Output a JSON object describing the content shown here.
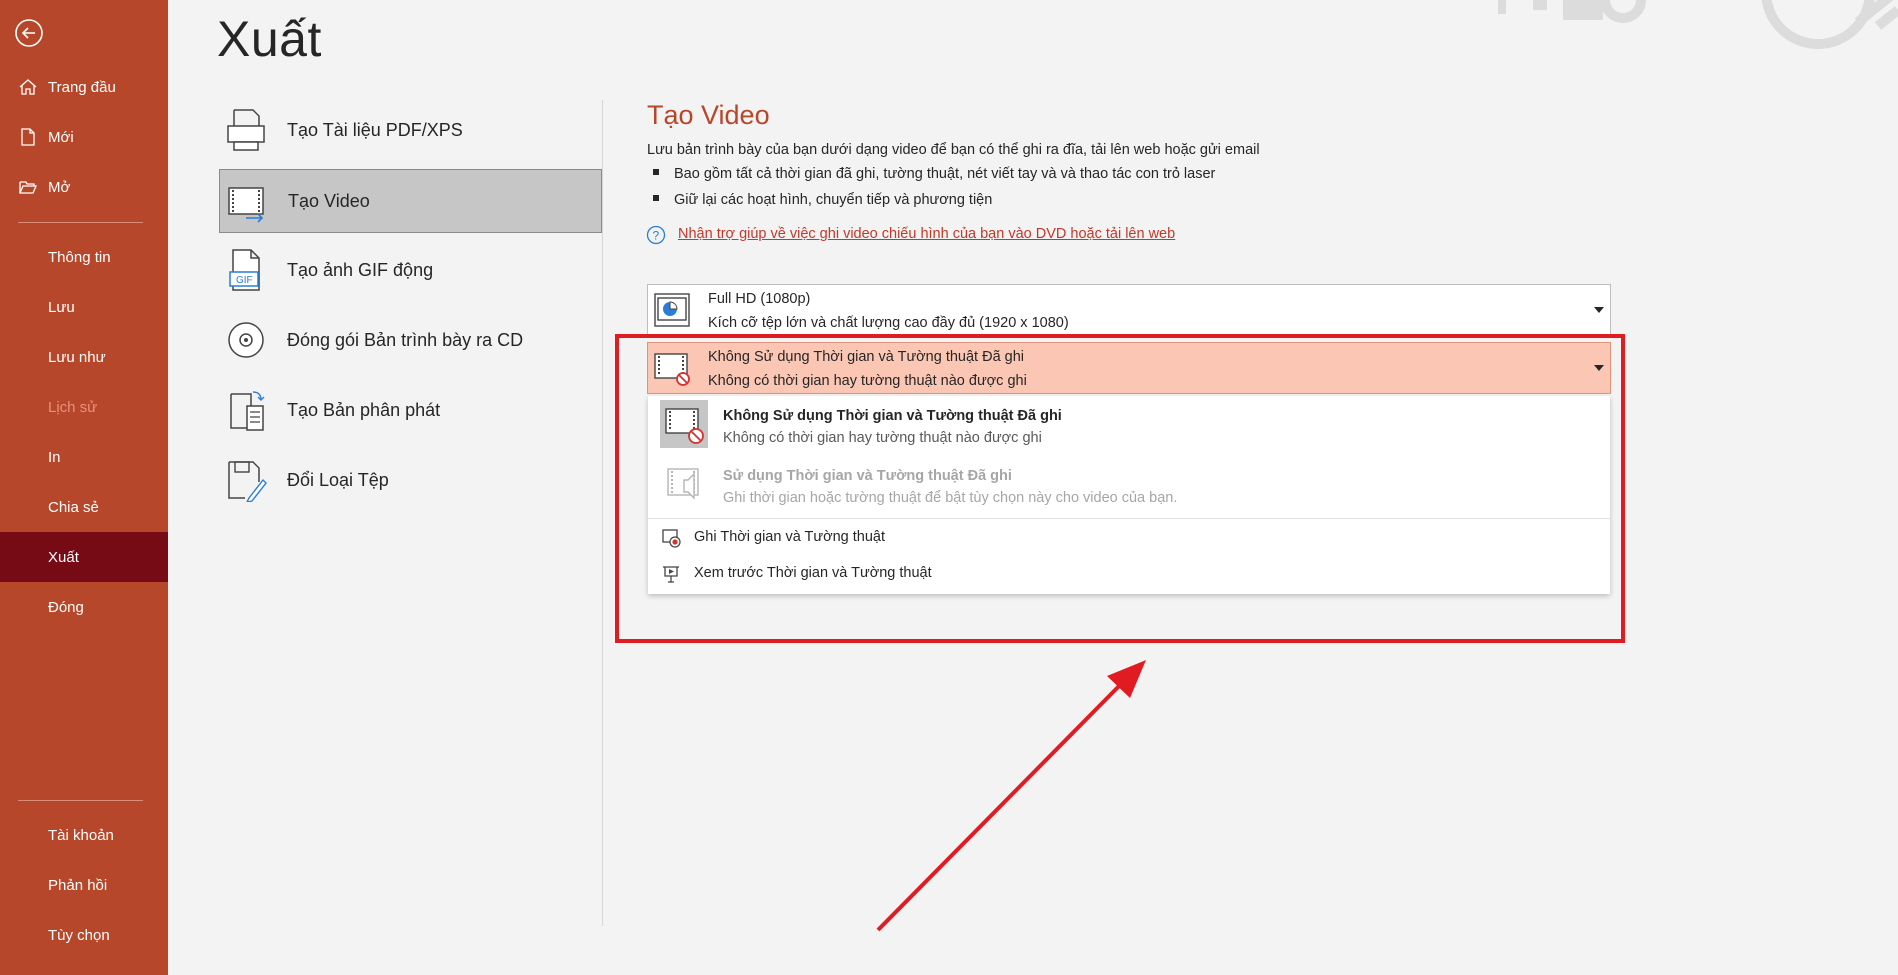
{
  "sidebar": {
    "items": [
      {
        "label": "Trang đầu"
      },
      {
        "label": "Mới"
      },
      {
        "label": "Mở"
      },
      {
        "label": "Thông tin"
      },
      {
        "label": "Lưu"
      },
      {
        "label": "Lưu như"
      },
      {
        "label": "Lịch sử"
      },
      {
        "label": "In"
      },
      {
        "label": "Chia sẻ"
      },
      {
        "label": "Xuất"
      },
      {
        "label": "Đóng"
      },
      {
        "label": "Tài khoản"
      },
      {
        "label": "Phản hồi"
      },
      {
        "label": "Tùy chọn"
      }
    ],
    "active": "Xuất",
    "disabled": "Lịch sử"
  },
  "page": {
    "title": "Xuất"
  },
  "export_options": [
    {
      "label": "Tạo Tài liệu PDF/XPS"
    },
    {
      "label": "Tạo Video"
    },
    {
      "label": "Tạo ảnh GIF động"
    },
    {
      "label": "Đóng gói Bản trình bày ra CD"
    },
    {
      "label": "Tạo Bản phân phát"
    },
    {
      "label": "Đổi Loại Tệp"
    }
  ],
  "video": {
    "title": "Tạo Video",
    "description": "Lưu bản trình bày của bạn dưới dạng video để bạn có thể ghi ra đĩa, tải lên web hoặc gửi email",
    "bullets": [
      "Bao gồm tất cả thời gian đã ghi, tường thuật, nét viết tay và và thao tác con trỏ laser",
      "Giữ lại các hoạt hình, chuyển tiếp và phương tiện"
    ],
    "help_link": "Nhận trợ giúp về việc ghi video chiếu hình của bạn vào DVD hoặc tải lên web",
    "quality_dropdown": {
      "line1": "Full HD (1080p)",
      "line2": "Kích cỡ tệp lớn và chất lượng cao đầy đủ (1920 x 1080)"
    },
    "timing_dropdown": {
      "line1": "Không Sử dụng Thời gian và Tường thuật Đã ghi",
      "line2": "Không có thời gian hay tường thuật nào được ghi"
    },
    "menu": {
      "items": [
        {
          "title": "Không Sử dụng Thời gian và Tường thuật Đã ghi",
          "desc": "Không có thời gian hay tường thuật nào được ghi"
        },
        {
          "title": "Sử dụng Thời gian và Tường thuật Đã ghi",
          "desc": "Ghi thời gian hoặc tường thuật để bật tùy chọn này cho video của bạn."
        }
      ],
      "actions": [
        {
          "label": "Ghi Thời gian và Tường thuật"
        },
        {
          "label": "Xem trước Thời gian và Tường thuật"
        }
      ]
    }
  },
  "colors": {
    "sidebar": "#b7472a",
    "sidebar_active": "#760b15",
    "accent": "#b7472a",
    "highlight": "#e11b22",
    "dropdown_open": "#fbc7b4"
  }
}
